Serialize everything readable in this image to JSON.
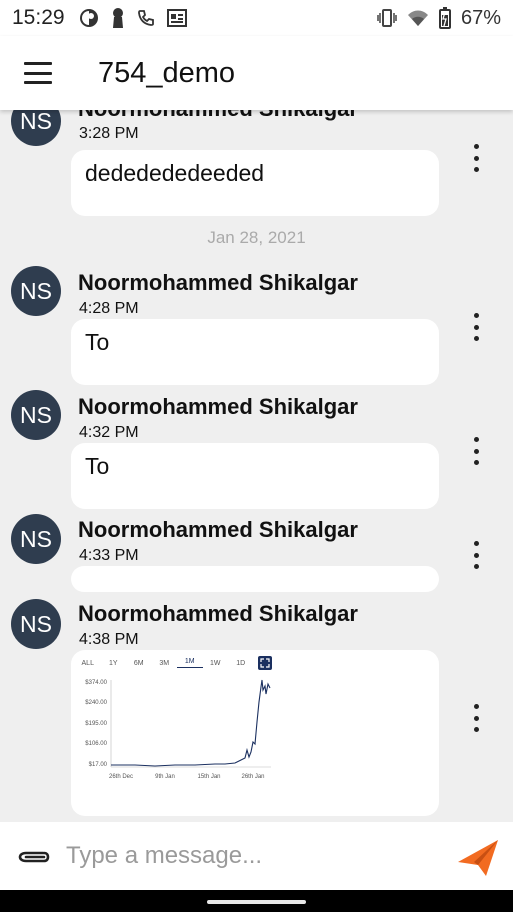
{
  "status_bar": {
    "time": "15:29",
    "battery": "67%",
    "icons": [
      "sync-icon",
      "pin-icon",
      "phone-icon",
      "news-icon",
      "vibrate-icon",
      "wifi-icon",
      "battery-icon"
    ]
  },
  "app_bar": {
    "title": "754_demo",
    "menu_icon": "hamburger-menu-icon"
  },
  "messages": [
    {
      "avatar": "NS",
      "sender": "Noormohammed Shikalgar",
      "time": "3:28 PM",
      "text": "dededededeeded"
    },
    {
      "avatar": "NS",
      "sender": "Noormohammed Shikalgar",
      "time": "4:28 PM",
      "text": "To"
    },
    {
      "avatar": "NS",
      "sender": "Noormohammed Shikalgar",
      "time": "4:32 PM",
      "text": "To"
    },
    {
      "avatar": "NS",
      "sender": "Noormohammed Shikalgar",
      "time": "4:33 PM",
      "text": ""
    },
    {
      "avatar": "NS",
      "sender": "Noormohammed Shikalgar",
      "time": "4:38 PM",
      "text": ""
    }
  ],
  "date_separator": "Jan 28, 2021",
  "attachment_image": {
    "tabs": [
      "ALL",
      "1Y",
      "6M",
      "3M",
      "1M",
      "1W",
      "1D"
    ],
    "active_tab": "1M",
    "y_ticks": [
      "$374.00",
      "$240.00",
      "$195.00",
      "$106.00",
      "$17.00"
    ],
    "x_ticks": [
      "26th Dec",
      "9th Jan",
      "15th Jan",
      "26th Jan"
    ],
    "line_color": "#1b3060"
  },
  "composer": {
    "placeholder": "Type a message...",
    "attach_icon": "paperclip-icon",
    "send_icon": "send-icon",
    "send_color": "#f26b21"
  }
}
